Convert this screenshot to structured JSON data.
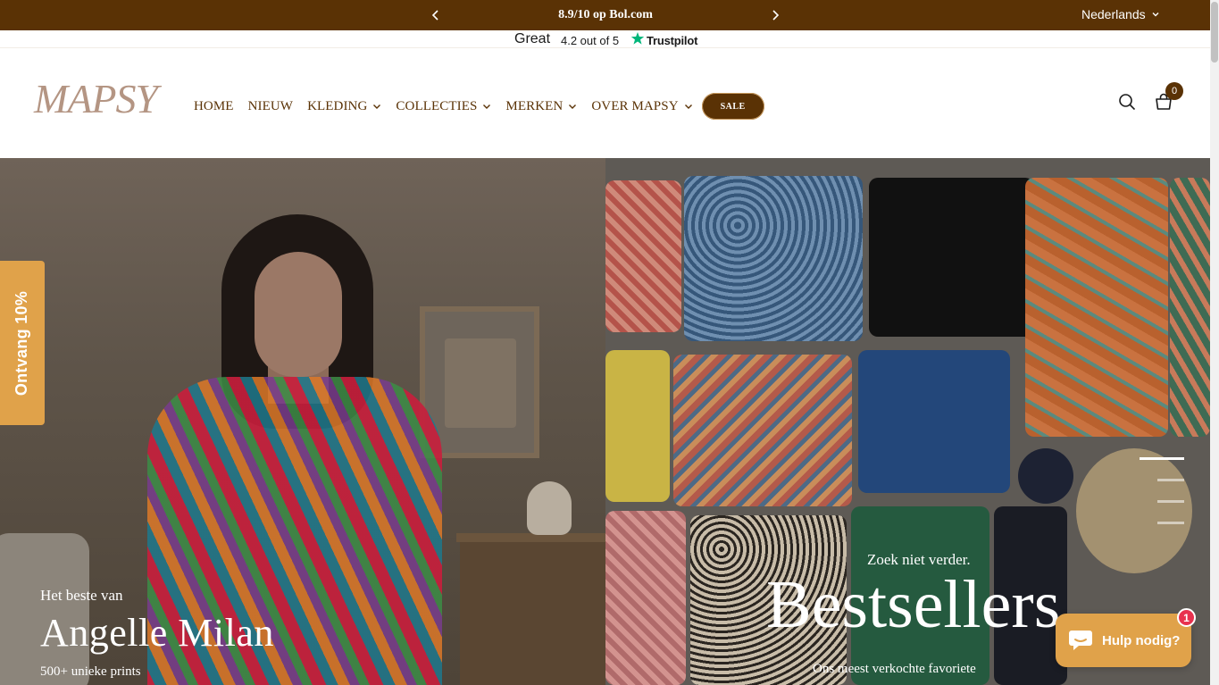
{
  "announcement": {
    "message": "8.9/10 op Bol.com",
    "language": "Nederlands"
  },
  "trustpilot": {
    "rating_word": "Great",
    "score_text": "4.2 out of 5",
    "brand": "Trustpilot"
  },
  "header": {
    "logo": "MAPSY",
    "nav": [
      {
        "label": "HOME",
        "dropdown": false
      },
      {
        "label": "NIEUW",
        "dropdown": false
      },
      {
        "label": "KLEDING",
        "dropdown": true
      },
      {
        "label": "COLLECTIES",
        "dropdown": true
      },
      {
        "label": "MERKEN",
        "dropdown": true
      },
      {
        "label": "OVER MAPSY",
        "dropdown": true
      }
    ],
    "sale_label": "SALE",
    "cart_count": "0"
  },
  "hero": {
    "left": {
      "eyebrow": "Het beste van",
      "title": "Angelle Milan",
      "sub": "500+ unieke prints"
    },
    "right": {
      "eyebrow": "Zoek niet verder.",
      "title": "Bestsellers",
      "sub": "Ons meest verkochte favoriete"
    },
    "pager_count": 4,
    "pager_active": 0
  },
  "side_tab": {
    "label": "Ontvang 10%"
  },
  "chat": {
    "label": "Hulp nodig?",
    "badge": "1"
  },
  "colors": {
    "brand_brown": "#5a3205",
    "accent_orange": "#e0a24a",
    "logo_rose": "#b49583",
    "trustpilot_green": "#00b67a",
    "badge_red": "#e8324f"
  }
}
